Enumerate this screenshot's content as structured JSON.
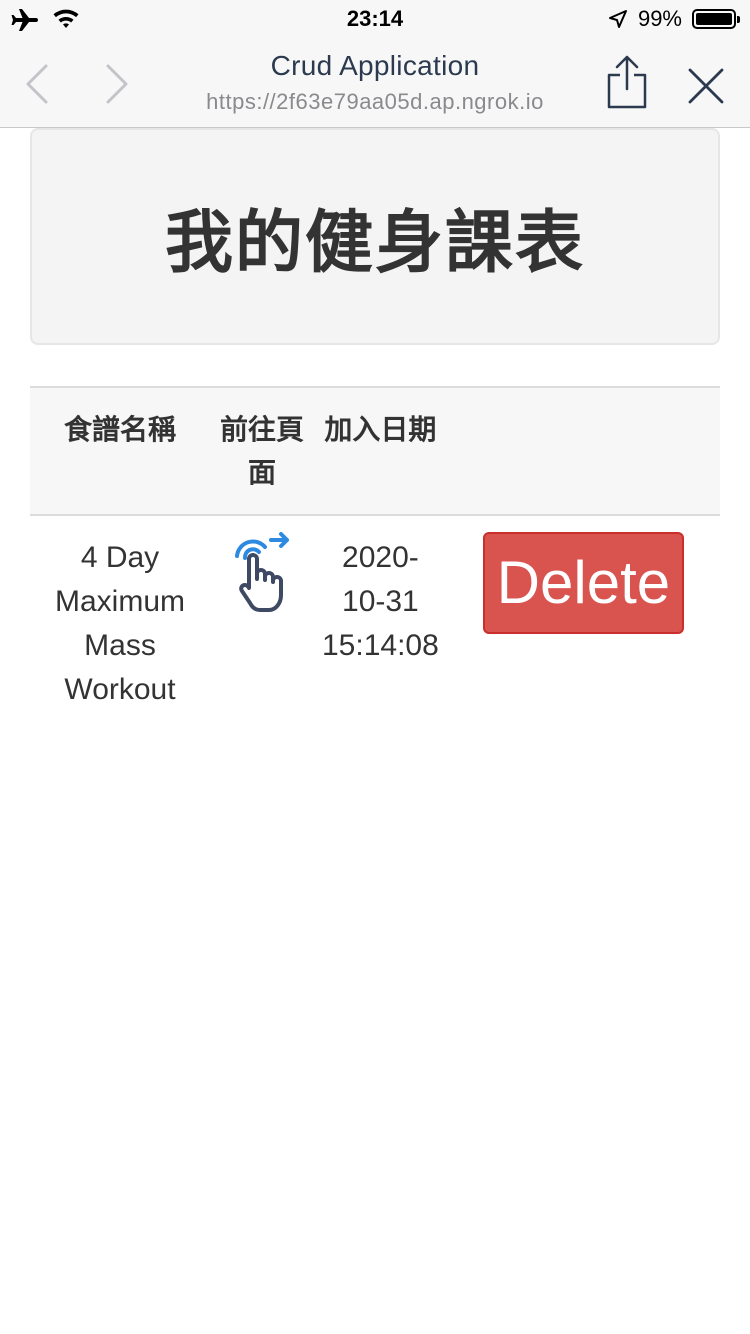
{
  "status_bar": {
    "time": "23:14",
    "battery": "99%",
    "battery_level": 0.99,
    "icons": [
      "airplane-icon",
      "wifi-icon",
      "location-arrow-icon",
      "battery-icon"
    ]
  },
  "nav": {
    "title": "Crud Application",
    "url": "https://2f63e79aa05d.ap.ngrok.io",
    "icons": [
      "back-icon",
      "forward-icon",
      "share-icon",
      "close-icon"
    ]
  },
  "page": {
    "heading": "我的健身課表"
  },
  "table": {
    "headers": [
      "食譜名稱",
      "前往頁面",
      "加入日期",
      ""
    ],
    "rows": [
      {
        "name": "4 Day Maximum Mass Workout",
        "go_icon": "tap-hand-icon",
        "date": "2020-10-31 15:14:08",
        "delete_label": "Delete"
      }
    ]
  },
  "colors": {
    "delete": "#d9534f",
    "icon_blue": "#2d8ae0",
    "icon_dark": "#3e4a63"
  }
}
